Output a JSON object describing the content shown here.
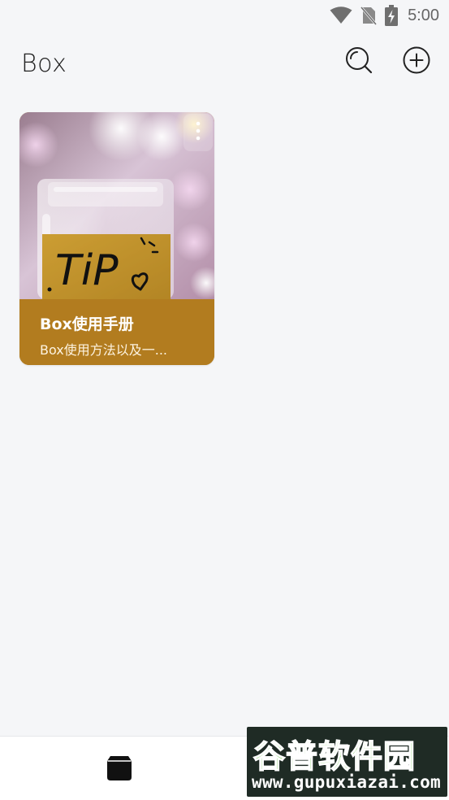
{
  "status_bar": {
    "time": "5:00",
    "icons": [
      "wifi-icon",
      "no-sim-icon",
      "battery-charging-icon"
    ]
  },
  "header": {
    "title": "Box",
    "search_icon": "search-icon",
    "add_icon": "add-circle-icon"
  },
  "cards": [
    {
      "title": "Box使用手册",
      "subtitle": "Box使用方法以及一...",
      "image_text": "TiP",
      "accent_color": "#b27c1f",
      "more_icon": "more-vertical-icon"
    }
  ],
  "bottom_nav": {
    "items": [
      {
        "icon": "box-icon"
      }
    ]
  },
  "watermark": {
    "title": "谷普软件园",
    "url": "www.gupuxiazai.com"
  }
}
